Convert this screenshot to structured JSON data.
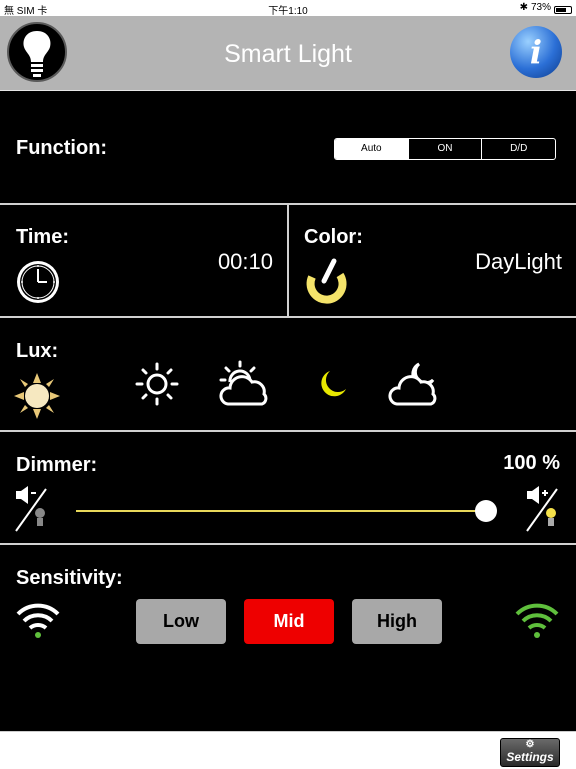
{
  "status_bar": {
    "carrier": "無 SIM 卡",
    "time": "下午1:10",
    "battery": "73%",
    "battery_level": 0.73
  },
  "nav": {
    "title": "Smart Light",
    "info_label": "i"
  },
  "function": {
    "label": "Function:",
    "options": [
      "Auto",
      "ON",
      "D/D"
    ],
    "selected": "Auto"
  },
  "time": {
    "label": "Time:",
    "value": "00:10"
  },
  "color": {
    "label": "Color:",
    "value": "DayLight"
  },
  "lux": {
    "label": "Lux:",
    "icons": [
      "bright-sun-icon",
      "sun-icon",
      "sun-cloud-icon",
      "moon-icon",
      "moon-cloud-icon"
    ]
  },
  "dimmer": {
    "label": "Dimmer:",
    "value": "100 %",
    "level": 1.0
  },
  "sensitivity": {
    "label": "Sensitivity:",
    "buttons": [
      "Low",
      "Mid",
      "High"
    ],
    "selected": "Mid"
  },
  "footer": {
    "settings_label": "Settings"
  },
  "colors": {
    "accent_red": "#ee0000",
    "slider_track": "#e8d85a",
    "wifi_green": "#5fbf3c"
  }
}
